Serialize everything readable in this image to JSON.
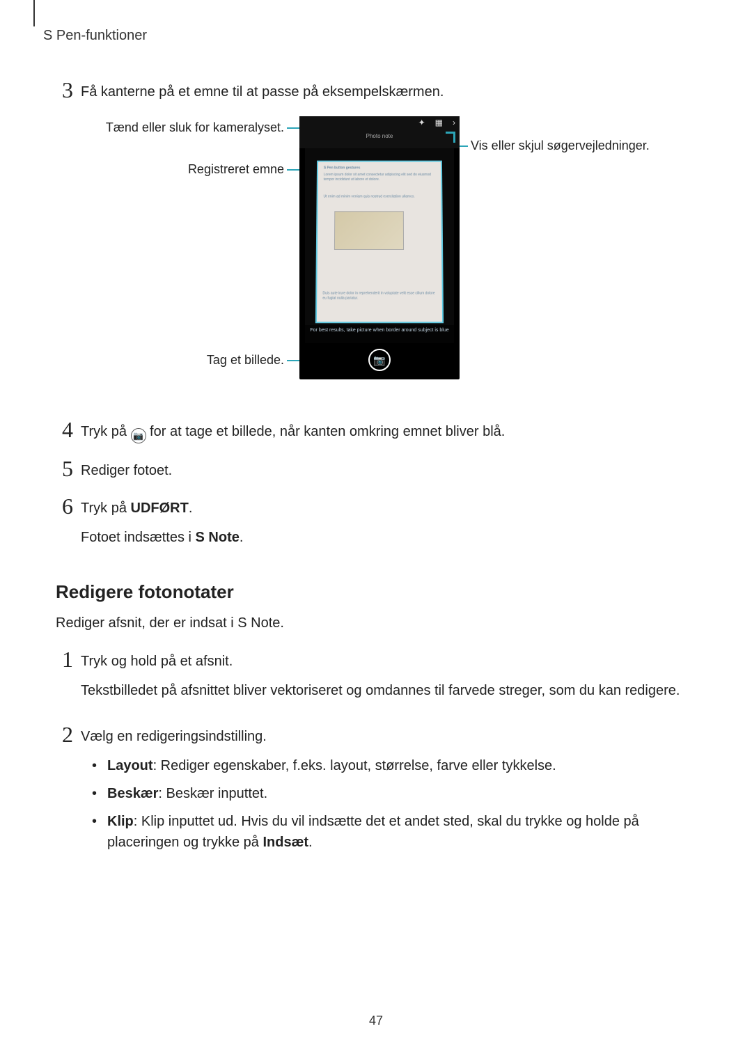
{
  "header": {
    "section": "S Pen-funktioner"
  },
  "steps_a": {
    "s3": {
      "num": "3",
      "text": "Få kanterne på et emne til at passe på eksempelskærmen."
    },
    "s4": {
      "num": "4",
      "pre": "Tryk på ",
      "post": " for at tage et billede, når kanten omkring emnet bliver blå."
    },
    "s5": {
      "num": "5",
      "text": "Rediger fotoet."
    },
    "s6": {
      "num": "6",
      "line1_pre": "Tryk på ",
      "line1_bold": "UDFØRT",
      "line1_post": ".",
      "line2_pre": "Fotoet indsættes i ",
      "line2_bold": "S Note",
      "line2_post": "."
    }
  },
  "callouts": {
    "flash": "Tænd eller sluk for kameralyset.",
    "subject": "Registreret emne",
    "capture": "Tag et billede.",
    "guides": "Vis eller skjul søgervejledninger."
  },
  "phone": {
    "statusbar_label": "Photo note",
    "doc_heading": "S Pen button gestures",
    "hint": "For best results, take picture when border around subject is blue"
  },
  "section2": {
    "heading": "Redigere fotonotater",
    "intro": "Rediger afsnit, der er indsat i S Note."
  },
  "steps_b": {
    "s1": {
      "num": "1",
      "line1": "Tryk og hold på et afsnit.",
      "line2": "Tekstbilledet på afsnittet bliver vektoriseret og omdannes til farvede streger, som du kan redigere."
    },
    "s2": {
      "num": "2",
      "text": "Vælg en redigeringsindstilling.",
      "items": {
        "layout": {
          "bold": "Layout",
          "rest": ": Rediger egenskaber, f.eks. layout, størrelse, farve eller tykkelse."
        },
        "crop": {
          "bold": "Beskær",
          "rest": ": Beskær inputtet."
        },
        "clip": {
          "bold": "Klip",
          "rest_pre": ": Klip inputtet ud. Hvis du vil indsætte det et andet sted, skal du trykke og holde på placeringen og trykke på ",
          "rest_bold": "Indsæt",
          "rest_post": "."
        }
      }
    }
  },
  "page": "47"
}
